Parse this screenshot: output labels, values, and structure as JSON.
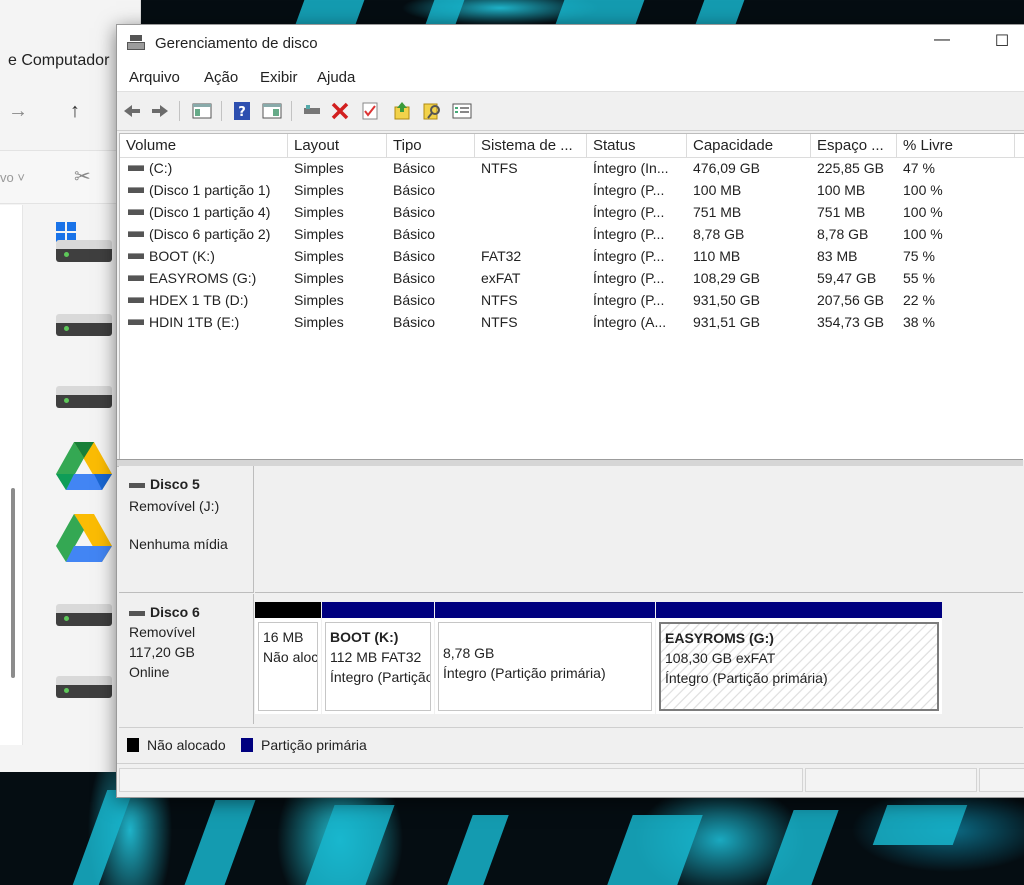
{
  "explorer": {
    "title_fragment": "e Computador",
    "partial_label": "vo"
  },
  "window": {
    "title": "Gerenciamento de disco"
  },
  "menu": [
    {
      "label": "Arquivo"
    },
    {
      "label": "Ação"
    },
    {
      "label": "Exibir"
    },
    {
      "label": "Ajuda"
    }
  ],
  "toolbar_icons": [
    "back-icon",
    "forward-icon",
    "console-tree-icon",
    "help-icon",
    "properties-icon",
    "connect-icon",
    "delete-icon",
    "check-icon",
    "import-icon",
    "search-icon",
    "list-view-icon"
  ],
  "volume_table": {
    "headers": [
      "Volume",
      "Layout",
      "Tipo",
      "Sistema de ...",
      "Status",
      "Capacidade",
      "Espaço ...",
      "% Livre"
    ],
    "rows": [
      [
        "(C:)",
        "Simples",
        "Básico",
        "NTFS",
        "Íntegro (In...",
        "476,09 GB",
        "225,85 GB",
        "47 %"
      ],
      [
        "(Disco 1 partição 1)",
        "Simples",
        "Básico",
        "",
        "Íntegro (P...",
        "100 MB",
        "100 MB",
        "100 %"
      ],
      [
        "(Disco 1 partição 4)",
        "Simples",
        "Básico",
        "",
        "Íntegro (P...",
        "751 MB",
        "751 MB",
        "100 %"
      ],
      [
        "(Disco 6 partição 2)",
        "Simples",
        "Básico",
        "",
        "Íntegro (P...",
        "8,78 GB",
        "8,78 GB",
        "100 %"
      ],
      [
        "BOOT (K:)",
        "Simples",
        "Básico",
        "FAT32",
        "Íntegro (P...",
        "110 MB",
        "83 MB",
        "75 %"
      ],
      [
        "EASYROMS (G:)",
        "Simples",
        "Básico",
        "exFAT",
        "Íntegro (P...",
        "108,29 GB",
        "59,47 GB",
        "55 %"
      ],
      [
        "HDEX 1 TB (D:)",
        "Simples",
        "Básico",
        "NTFS",
        "Íntegro (P...",
        "931,50 GB",
        "207,56 GB",
        "22 %"
      ],
      [
        "HDIN 1TB (E:)",
        "Simples",
        "Básico",
        "NTFS",
        "Íntegro (A...",
        "931,51 GB",
        "354,73 GB",
        "38 %"
      ]
    ]
  },
  "disks": [
    {
      "name": "Disco 5",
      "type": "Removível (J:)",
      "status": "Nenhuma mídia"
    },
    {
      "name": "Disco 6",
      "type": "Removível",
      "size": "117,20 GB",
      "status": "Online",
      "partitions": [
        {
          "name": "",
          "line1": "16 MB",
          "line2": "Não alocado",
          "kind": "unallocated"
        },
        {
          "name": "BOOT  (K:)",
          "line1": "112 MB FAT32",
          "line2": "Íntegro (Partição primária)",
          "kind": "primary"
        },
        {
          "name": "",
          "line1": "8,78 GB",
          "line2": "Íntegro (Partição primária)",
          "kind": "primary"
        },
        {
          "name": "EASYROMS  (G:)",
          "line1": "108,30 GB exFAT",
          "line2": "Íntegro (Partição primária)",
          "kind": "primary"
        }
      ]
    }
  ],
  "legend": [
    {
      "label": "Não alocado",
      "color": "#000000"
    },
    {
      "label": "Partição primária",
      "color": "#00007f"
    }
  ],
  "colors": {
    "primary_bar": "#00007f",
    "unallocated_bar": "#000000",
    "accent_cyan": "#18b5cc"
  }
}
